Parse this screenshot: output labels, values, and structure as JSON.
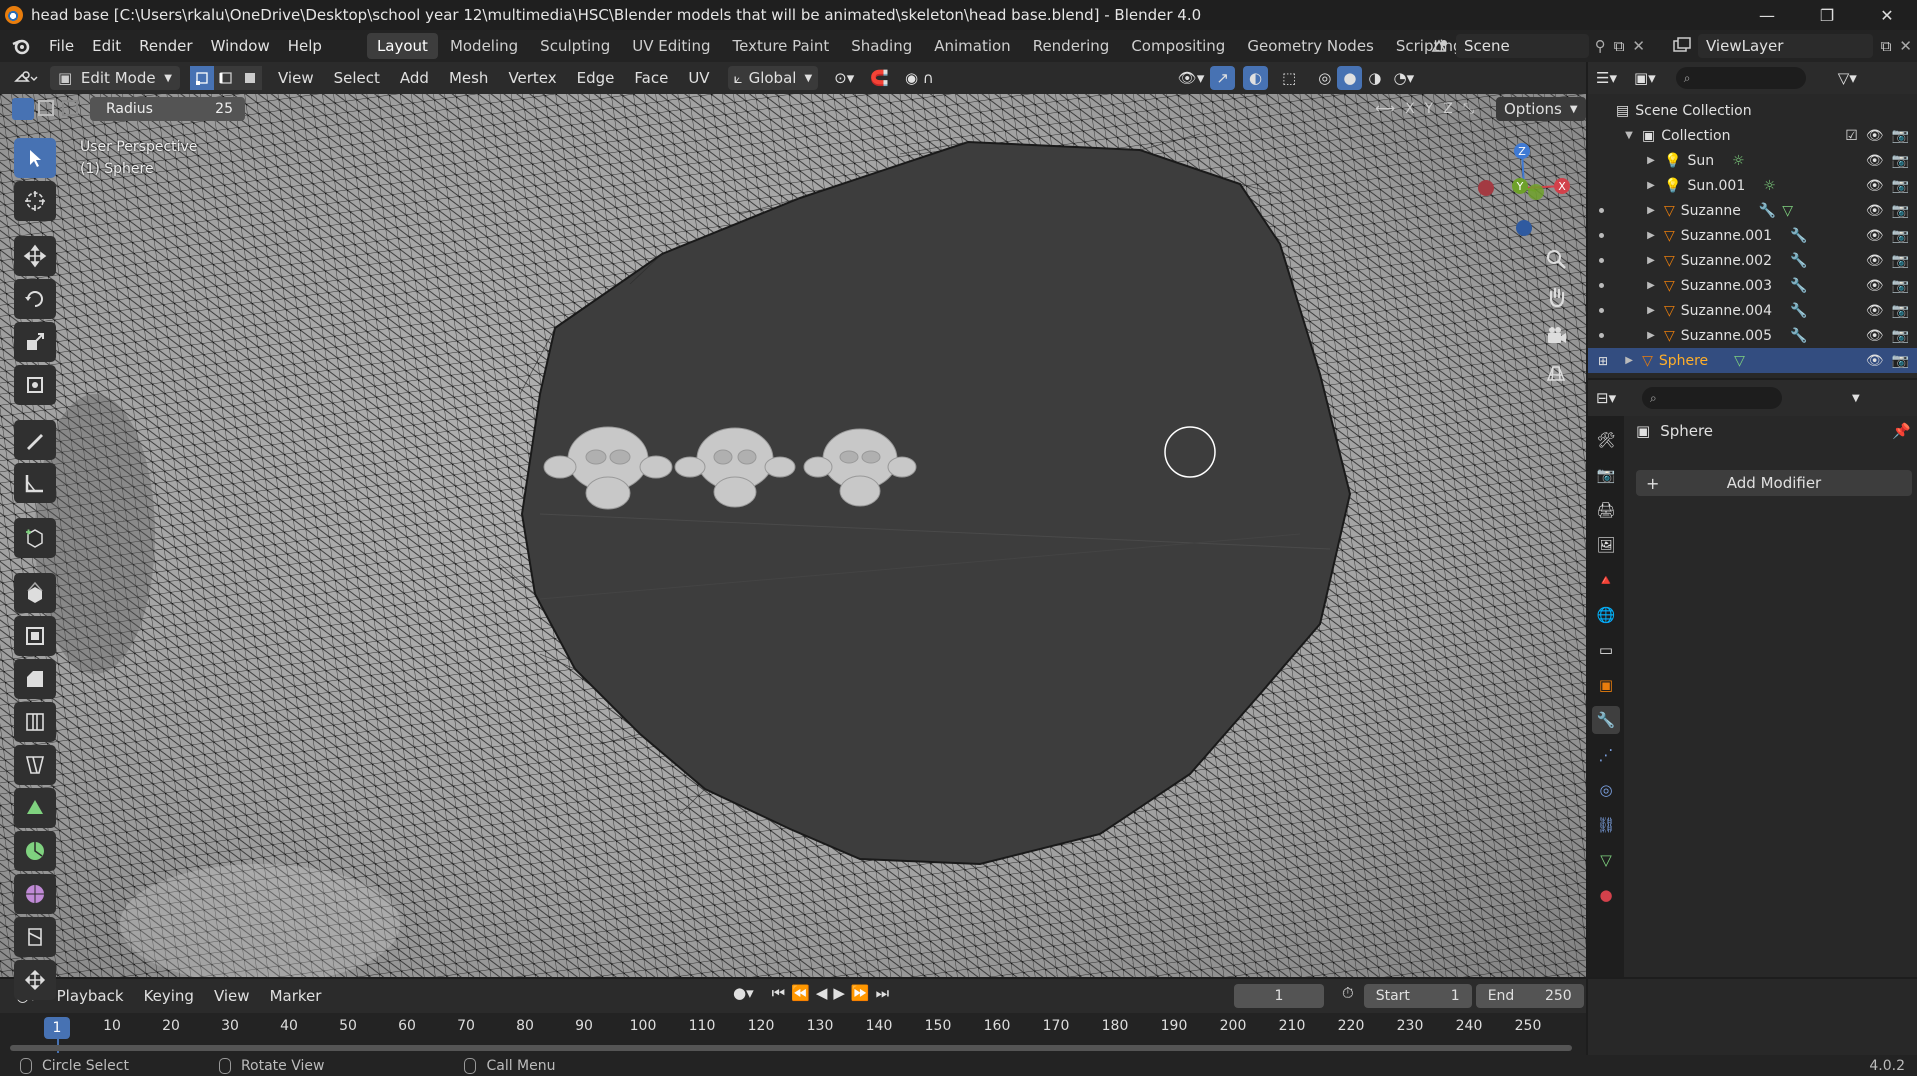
{
  "window": {
    "title": "head base [C:\\Users\\rkalu\\OneDrive\\Desktop\\school year 12\\multimedia\\HSC\\Blender models that will be animated\\skeleton\\head base.blend] - Blender 4.0",
    "controls": [
      "—",
      "❐",
      "✕"
    ]
  },
  "menu": {
    "items": [
      "File",
      "Edit",
      "Render",
      "Window",
      "Help"
    ],
    "workspaces": [
      "Layout",
      "Modeling",
      "Sculpting",
      "UV Editing",
      "Texture Paint",
      "Shading",
      "Animation",
      "Rendering",
      "Compositing",
      "Geometry Nodes",
      "Scripting"
    ],
    "active_workspace": "Layout",
    "scene": "Scene",
    "view_layer": "ViewLayer"
  },
  "viewport_header": {
    "mode": "Edit Mode",
    "menus": [
      "View",
      "Select",
      "Add",
      "Mesh",
      "Vertex",
      "Edge",
      "Face",
      "UV"
    ],
    "orientation": "Global",
    "axes": [
      "X",
      "Y",
      "Z"
    ],
    "options": "Options"
  },
  "tool_settings": {
    "radius_label": "Radius",
    "radius_value": "25"
  },
  "viewport": {
    "perspective": "User Perspective",
    "object": "(1) Sphere",
    "gizmo": {
      "x": "X",
      "y": "Y",
      "z": "Z"
    }
  },
  "toolbar": {
    "tools": [
      "select-box",
      "cursor",
      "move",
      "rotate",
      "scale",
      "transform",
      "annotate",
      "measure",
      "add-cube",
      "extrude",
      "inset",
      "bevel",
      "loop-cut",
      "knife",
      "poly-build",
      "spin",
      "smooth",
      "edge-slide",
      "shrink-fatten"
    ],
    "active": "select-box"
  },
  "outliner": {
    "root": "Scene Collection",
    "collection": "Collection",
    "items": [
      {
        "name": "Sun",
        "type": "light",
        "extra": "sun"
      },
      {
        "name": "Sun.001",
        "type": "light",
        "extra": "sun"
      },
      {
        "name": "Suzanne",
        "type": "mesh",
        "extra": "modifier+mesh"
      },
      {
        "name": "Suzanne.001",
        "type": "mesh",
        "extra": "modifier"
      },
      {
        "name": "Suzanne.002",
        "type": "mesh",
        "extra": "modifier"
      },
      {
        "name": "Suzanne.003",
        "type": "mesh",
        "extra": "modifier"
      },
      {
        "name": "Suzanne.004",
        "type": "mesh",
        "extra": "modifier"
      },
      {
        "name": "Suzanne.005",
        "type": "mesh",
        "extra": "modifier"
      }
    ],
    "selected": "Sphere"
  },
  "properties": {
    "object_name": "Sphere",
    "add_modifier": "Add Modifier"
  },
  "timeline": {
    "menus": [
      "Playback",
      "Keying",
      "View",
      "Marker"
    ],
    "current_frame": "1",
    "start_label": "Start",
    "start": "1",
    "end_label": "End",
    "end": "250",
    "ticks": [
      "10",
      "20",
      "30",
      "40",
      "50",
      "60",
      "70",
      "80",
      "90",
      "100",
      "110",
      "120",
      "130",
      "140",
      "150",
      "160",
      "170",
      "180",
      "190",
      "200",
      "210",
      "220",
      "230",
      "240",
      "250"
    ],
    "cursor_frame": "1"
  },
  "status": {
    "items": [
      "Circle Select",
      "Rotate View",
      "Call Menu"
    ],
    "version": "4.0.2"
  },
  "colors": {
    "accent": "#4772b3",
    "selected_text": "#ffaf29",
    "mesh_orange": "#e87d0d"
  }
}
